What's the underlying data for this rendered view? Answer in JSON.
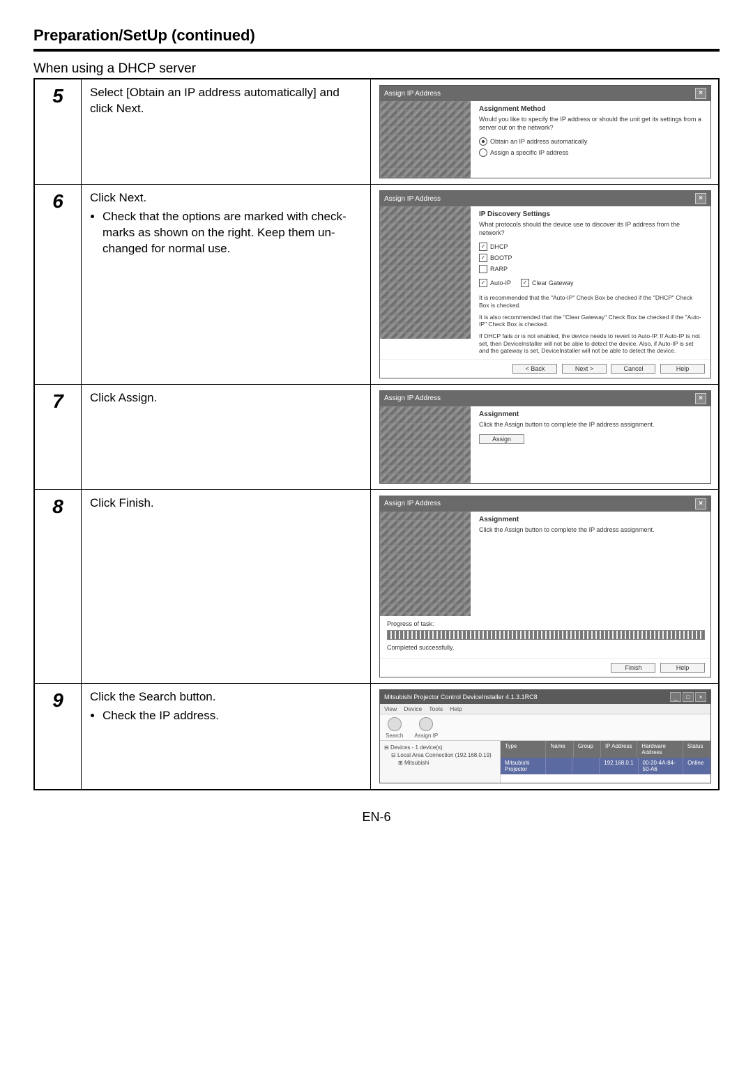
{
  "page_title": "Preparation/SetUp (continued)",
  "subheading": "When using a DHCP server",
  "page_number": "EN-6",
  "steps": [
    {
      "num": "5",
      "desc_main": "Select [Obtain an IP address automatically] and click Next.",
      "bullets": []
    },
    {
      "num": "6",
      "desc_main": "Click Next.",
      "bullets": [
        "Check that the options are marked with check-marks as shown on the right. Keep them un-changed for normal use."
      ]
    },
    {
      "num": "7",
      "desc_main": "Click Assign.",
      "bullets": []
    },
    {
      "num": "8",
      "desc_main": "Click Finish.",
      "bullets": []
    },
    {
      "num": "9",
      "desc_main": "Click the Search button.",
      "bullets": [
        "Check the IP address."
      ]
    }
  ],
  "dlg5": {
    "title": "Assign IP Address",
    "heading": "Assignment Method",
    "text": "Would you like to specify the IP address or should the unit get its settings from a server out on the network?",
    "opt1": "Obtain an IP address automatically",
    "opt2": "Assign a specific IP address"
  },
  "dlg6": {
    "title": "Assign IP Address",
    "heading": "IP Discovery Settings",
    "text": "What protocols should the device use to discover its IP address from the network?",
    "chk_dhcp": "DHCP",
    "chk_bootp": "BOOTP",
    "chk_rarp": "RARP",
    "chk_autoip": "Auto-IP",
    "chk_clear": "Clear Gateway",
    "note1": "It is recommended that the \"Auto-IP\" Check Box be checked if the \"DHCP\" Check Box is checked.",
    "note2": "It is also recommended that the \"Clear Gateway\" Check Box be checked if the \"Auto-IP\" Check Box is checked.",
    "note3": "If DHCP fails or is not enabled, the device needs to revert to Auto-IP.  If Auto-IP is not set, then DeviceInstaller will not be able to detect the device.  Also, if Auto-IP is set and the gateway is set, DeviceInstaller will not be able to detect the device.",
    "btn_back": "< Back",
    "btn_next": "Next >",
    "btn_cancel": "Cancel",
    "btn_help": "Help"
  },
  "dlg7": {
    "title": "Assign IP Address",
    "heading": "Assignment",
    "text": "Click the Assign button to complete the IP address assignment.",
    "btn_assign": "Assign"
  },
  "dlg8": {
    "title": "Assign IP Address",
    "heading": "Assignment",
    "text": "Click the Assign button to complete the IP address assignment.",
    "progress_label": "Progress of task:",
    "done": "Completed successfully.",
    "btn_finish": "Finish",
    "btn_help": "Help"
  },
  "win9": {
    "title": "Mitsubishi Projector Control DeviceInstaller 4.1.3.1RC8",
    "menu": {
      "m1": "View",
      "m2": "Device",
      "m3": "Tools",
      "m4": "Help"
    },
    "tool_search": "Search",
    "tool_assign": "Assign IP",
    "tree_root": "Devices - 1 device(s)",
    "tree_conn": "Local Area Connection (192.168.0.19)",
    "tree_brand": "Mitsubishi",
    "cols": {
      "c1": "Type",
      "c2": "Name",
      "c3": "Group",
      "c4": "IP Address",
      "c5": "Hardware Address",
      "c6": "Status"
    },
    "row": {
      "c1": "Mitsubishi Projector",
      "c2": "",
      "c3": "",
      "c4": "192.168.0.1",
      "c5": "00-20-4A-84-50-A6",
      "c6": "Online"
    }
  }
}
